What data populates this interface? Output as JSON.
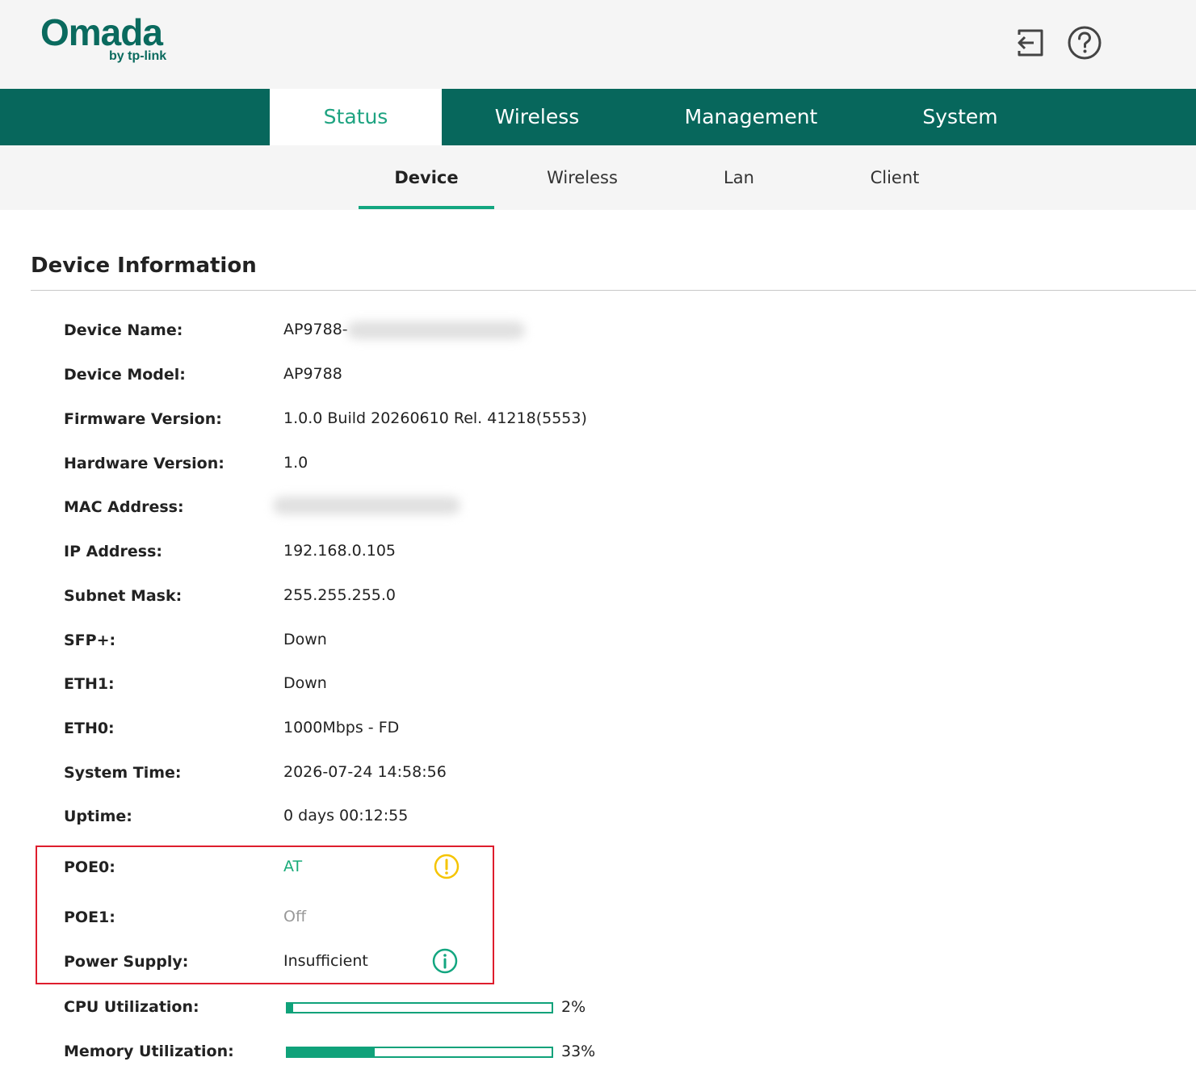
{
  "brand": {
    "name": "Omada",
    "sub": "by tp-link"
  },
  "header_icons": [
    "logout-icon",
    "help-icon"
  ],
  "main_nav": [
    "Status",
    "Wireless",
    "Management",
    "System"
  ],
  "main_nav_active": "Status",
  "sub_nav": [
    "Device",
    "Wireless",
    "Lan",
    "Client"
  ],
  "sub_nav_active": "Device",
  "section_title": "Device Information",
  "fields": {
    "device_name": {
      "label": "Device Name:",
      "value": "AP9788-"
    },
    "device_model": {
      "label": "Device Model:",
      "value": "AP9788"
    },
    "firmware_version": {
      "label": "Firmware Version:",
      "value": "1.0.0 Build 20260610 Rel. 41218(5553)"
    },
    "hardware_version": {
      "label": "Hardware Version:",
      "value": "1.0"
    },
    "mac_address": {
      "label": "MAC Address:",
      "value": ""
    },
    "ip_address": {
      "label": "IP Address:",
      "value": "192.168.0.105"
    },
    "subnet_mask": {
      "label": "Subnet Mask:",
      "value": "255.255.255.0"
    },
    "sfp_plus": {
      "label": "SFP+:",
      "value": "Down"
    },
    "eth1": {
      "label": "ETH1:",
      "value": "Down"
    },
    "eth0": {
      "label": "ETH0:",
      "value": "1000Mbps - FD"
    },
    "system_time": {
      "label": "System Time:",
      "value": "2026-07-24 14:58:56"
    },
    "uptime": {
      "label": "Uptime:",
      "value": "0 days 00:12:55"
    },
    "poe0": {
      "label": "POE0:",
      "value": "AT",
      "icon": "warning-icon"
    },
    "poe1": {
      "label": "POE1:",
      "value": "Off"
    },
    "power_supply": {
      "label": "Power Supply:",
      "value": "Insufficient",
      "icon": "info-icon"
    },
    "cpu_utilization": {
      "label": "CPU Utilization:",
      "value": "2%",
      "fraction": 0.02
    },
    "memory_utilization": {
      "label": "Memory Utilization:",
      "value": "33%",
      "fraction": 0.33
    }
  },
  "colors": {
    "nav_bg": "#07675c",
    "accent": "#13a680",
    "active_tab_text": "#1ea381",
    "warning": "#f5c400",
    "highlight_border": "#de1d2d"
  }
}
